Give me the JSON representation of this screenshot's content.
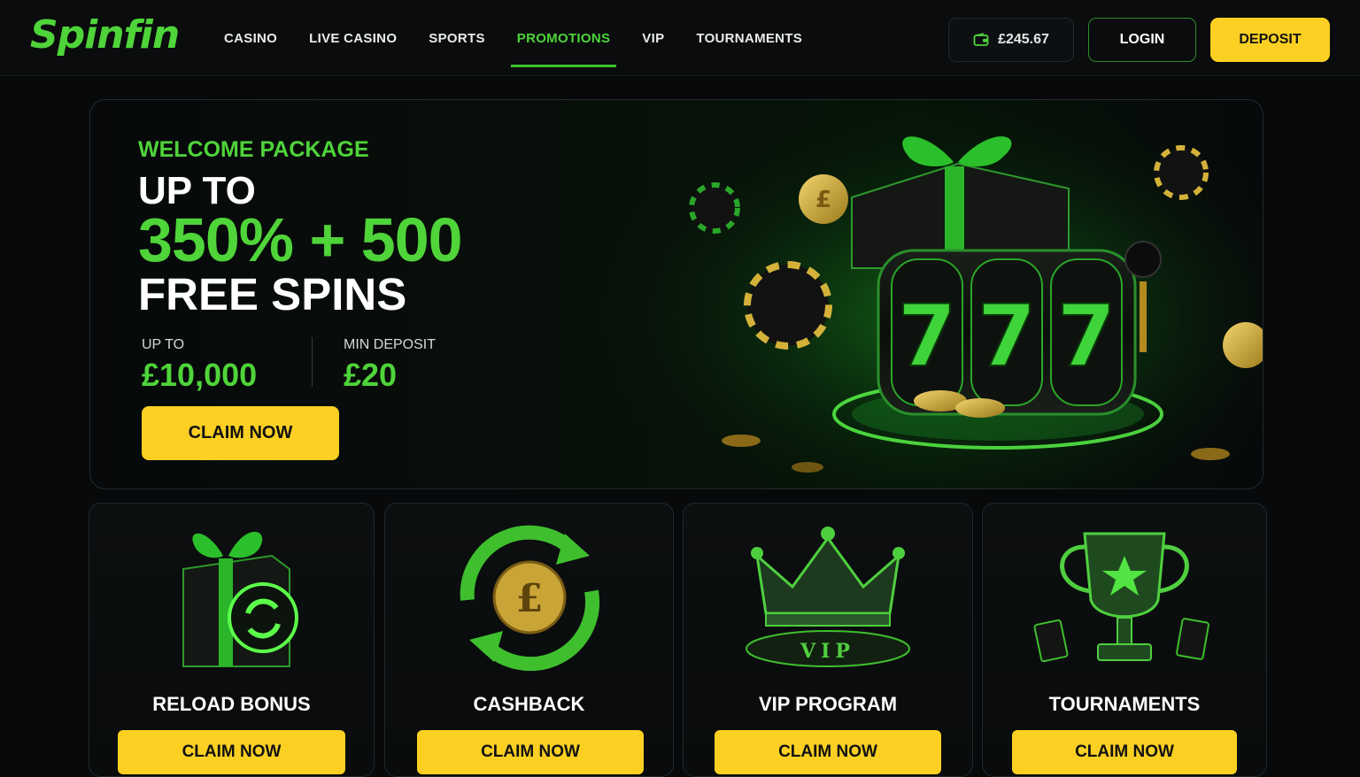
{
  "brand": {
    "logo": "Spinfin",
    "accent": "#4fd43a",
    "cta_color": "#fcd023"
  },
  "nav": {
    "items": [
      {
        "label": "CASINO",
        "active": false
      },
      {
        "label": "LIVE CASINO",
        "active": false
      },
      {
        "label": "SPORTS",
        "active": false
      },
      {
        "label": "PROMOTIONS",
        "active": true
      },
      {
        "label": "VIP",
        "active": false
      },
      {
        "label": "TOURNAMENTS",
        "active": false
      }
    ]
  },
  "account": {
    "balance": "£245.67",
    "wallet_icon": "wallet-icon",
    "login_label": "LOGIN",
    "deposit_label": "DEPOSIT"
  },
  "hero": {
    "eyebrow": "WELCOME PACKAGE",
    "line1": "UP TO",
    "line2": "350% + 500",
    "line3": "FREE SPINS",
    "stats": [
      {
        "label": "UP TO",
        "value": "£10,000"
      },
      {
        "label": "MIN DEPOSIT",
        "value": "£20"
      }
    ],
    "cta": "CLAIM NOW",
    "art_reel": [
      "7",
      "7",
      "7"
    ]
  },
  "promos": [
    {
      "title": "RELOAD BONUS",
      "icon": "gift-reload-icon",
      "cta": "CLAIM NOW"
    },
    {
      "title": "CASHBACK",
      "icon": "cashback-coin-icon",
      "cta": "CLAIM NOW",
      "coin_symbol": "£"
    },
    {
      "title": "VIP PROGRAM",
      "icon": "crown-icon",
      "cta": "CLAIM NOW",
      "pedestal_text": "VIP"
    },
    {
      "title": "TOURNAMENTS",
      "icon": "trophy-icon",
      "cta": "CLAIM NOW"
    }
  ]
}
